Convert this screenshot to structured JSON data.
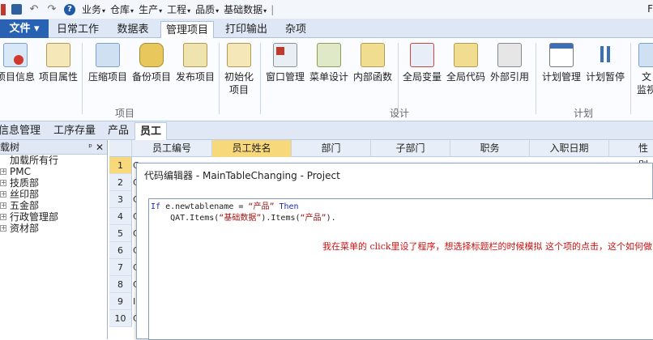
{
  "quick_access": {
    "menus": [
      "业务",
      "仓库",
      "生产",
      "工程",
      "品质",
      "基础数据"
    ],
    "right_label": "F"
  },
  "ribbon_tabs": {
    "file": "文件",
    "tabs": [
      "日常工作",
      "数据表",
      "管理项目",
      "打印输出",
      "杂项"
    ],
    "active": "管理项目"
  },
  "ribbon": {
    "buttons": {
      "project_info": "项目信息",
      "project_props": "项目属性",
      "compress": "压缩项目",
      "backup": "备份项目",
      "publish": "发布项目",
      "init_line1": "初始化",
      "init_line2": "项目",
      "window_mgmt": "窗口管理",
      "menu_design": "菜单设计",
      "internal_func": "内部函数",
      "global_var": "全局变量",
      "global_code": "全局代码",
      "external_ref": "外部引用",
      "plan_mgmt": "计划管理",
      "plan_pause": "计划暂停",
      "doc_line1": "文",
      "doc_line2": "监视"
    },
    "groups": {
      "project": "项目",
      "design": "设计",
      "plan": "计划"
    }
  },
  "doc_tabs": [
    "信息管理",
    "工序存量",
    "产品",
    "员工"
  ],
  "tree": {
    "title": "载树",
    "nodes": [
      "加载所有行",
      "PMC",
      "技质部",
      "丝印部",
      "五金部",
      "行政管理部",
      "资材部"
    ]
  },
  "grid": {
    "columns": [
      "员工编号",
      "员工姓名",
      "部门",
      "子部门",
      "职务",
      "入职日期",
      "性别"
    ],
    "selected_column": "员工姓名",
    "rows": [
      "1",
      "2",
      "3",
      "4",
      "5",
      "6",
      "7",
      "8",
      "9",
      "10"
    ],
    "row_stub": [
      "C",
      "C",
      "C",
      "C",
      "C",
      "C",
      "C",
      "C",
      "I",
      "C"
    ]
  },
  "dialog": {
    "title": "代码编辑器 - MainTableChanging - Project",
    "code": {
      "l1_if": "If",
      "l1_expr": " e.newtablename = ",
      "l1_str": "“产品”",
      "l1_then": " Then",
      "l2_pre": "    QAT.Items(",
      "l2_str1": "“基础数据”",
      "l2_mid": ").Items(",
      "l2_str2": "“产品”",
      "l2_end": ")."
    },
    "note": "我在菜单的 click里设了程序，想选择标题栏的时候模拟 这个项的点击，这个如何做"
  }
}
